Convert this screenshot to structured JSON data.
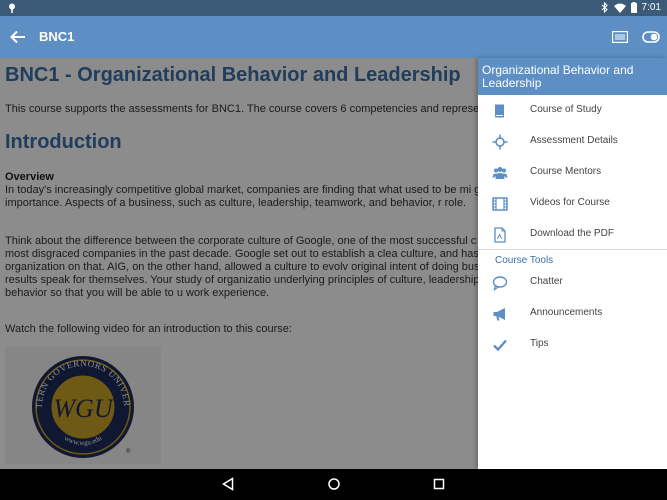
{
  "status_bar": {
    "time": "7:01"
  },
  "app_bar": {
    "title": "BNC1"
  },
  "content": {
    "heading": "BNC1 - Organizational Behavior and Leadership",
    "intro_line": "This course supports the assessments for BNC1. The course covers 6 competencies and represe",
    "section_heading": "Introduction",
    "overview_label": "Overview",
    "overview_text": "In today's increasingly competitive global market, companies are finding that what used to be mi greater importance. Aspects of a business, such as culture, leadership, teamwork, and behavior, r role.",
    "paragraph_2": "Think about the difference between the corporate culture of Google, one of the most successful c AIG, one of the most disgraced companies in the past decade. Google set out to establish a clea culture, and has based its organization on that. AIG, on the other hand, allowed a culture to evolv original intent of doing business, and the results speak for themselves. Your study of organizatio underlying principles of culture, leadership, teamwork, and behavior so that you will be able to u work experience.",
    "video_prompt": "Watch the following video for an introduction to this course:",
    "logo": {
      "arc_text": "WESTERN GOVERNORS UNIVERSITY",
      "monogram": "WGU",
      "url": "www.wgu.edu"
    }
  },
  "drawer": {
    "title": "Organizational Behavior and Leadership",
    "items": [
      {
        "label": "Course of Study",
        "icon": "book-icon"
      },
      {
        "label": "Assessment Details",
        "icon": "crosshair-icon"
      },
      {
        "label": "Course Mentors",
        "icon": "people-icon"
      },
      {
        "label": "Videos for Course",
        "icon": "film-icon"
      },
      {
        "label": "Download the PDF",
        "icon": "pdf-icon"
      }
    ],
    "tools_label": "Course Tools",
    "tools": [
      {
        "label": "Chatter",
        "icon": "chat-bubble-icon"
      },
      {
        "label": "Announcements",
        "icon": "megaphone-icon"
      },
      {
        "label": "Tips",
        "icon": "checkmark-icon"
      }
    ]
  },
  "colors": {
    "app_bar": "#5d8fc4",
    "status_bar": "#3a5a78",
    "heading": "#3c6fa8",
    "logo_gold": "#c9a227",
    "logo_navy": "#1d2a5a"
  }
}
